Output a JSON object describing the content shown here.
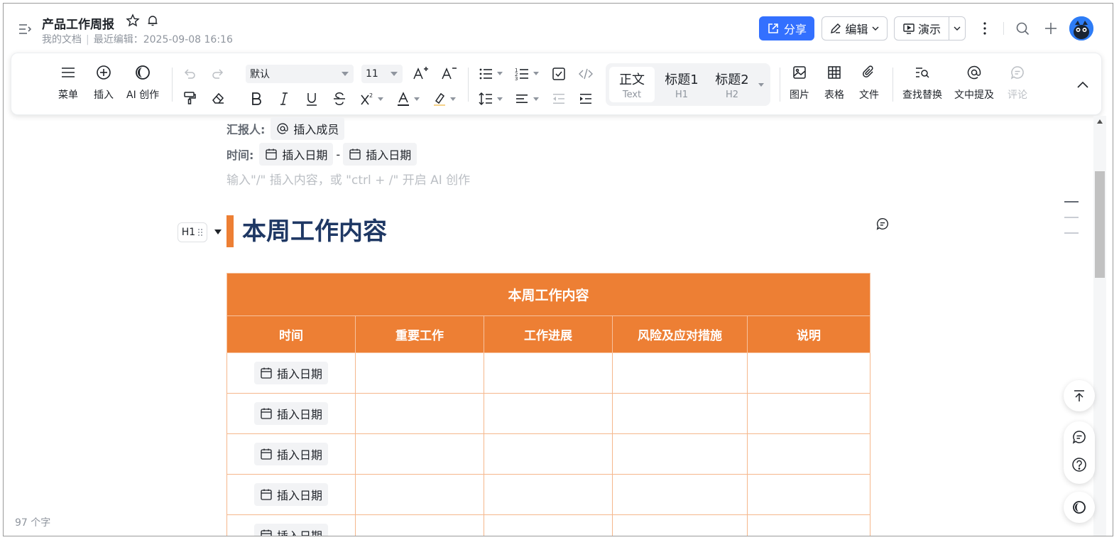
{
  "header": {
    "title": "产品工作周报",
    "location": "我的文档",
    "last_edit_label": "最近编辑：2025-09-08 16:16",
    "share_label": "分享",
    "edit_label": "编辑",
    "present_label": "演示"
  },
  "toolbar": {
    "menu": "菜单",
    "insert": "插入",
    "ai_create": "AI 创作",
    "font_family": "默认",
    "font_size": "11",
    "styles": [
      {
        "title": "正文",
        "sub": "Text"
      },
      {
        "title": "标题1",
        "sub": "H1"
      },
      {
        "title": "标题2",
        "sub": "H2"
      }
    ],
    "image": "图片",
    "table": "表格",
    "file": "文件",
    "find_replace": "查找替换",
    "mention": "文中提及",
    "comment": "评论"
  },
  "doc": {
    "reporter_label": "汇报人:",
    "insert_member": "插入成员",
    "time_label": "时间:",
    "insert_date": "插入日期",
    "date_sep": "-",
    "placeholder": "输入\"/\" 插入内容，或 \"ctrl + /\" 开启 AI 创作",
    "h1_handle": "H1",
    "heading": "本周工作内容"
  },
  "table": {
    "title": "本周工作内容",
    "columns": [
      "时间",
      "重要工作",
      "工作进展",
      "风险及应对措施",
      "说明"
    ],
    "row_date_label": "插入日期",
    "row_count": 5
  },
  "footer": {
    "word_count": "97 个字"
  },
  "colors": {
    "accent": "#3370ff",
    "table_header": "#ed7f34",
    "heading": "#1f3864"
  }
}
